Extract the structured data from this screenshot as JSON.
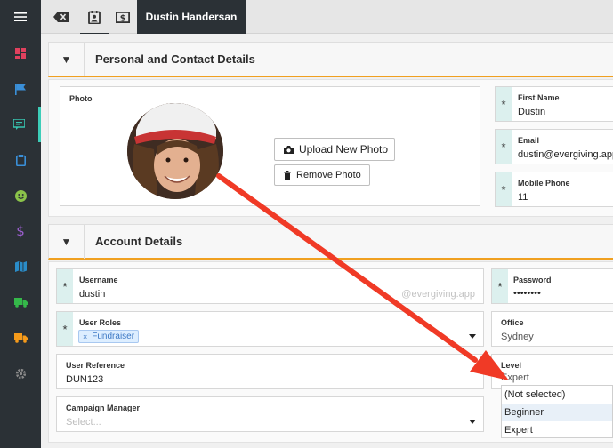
{
  "topbar": {
    "tab_name": "Dustin Handersan",
    "icons": [
      "backspace-icon",
      "contact-card-icon",
      "dollar-bill-icon"
    ]
  },
  "sidebar": {
    "items": [
      {
        "icon": "dashboard-icon",
        "color": "#e0415e"
      },
      {
        "icon": "flag-icon",
        "color": "#3a8fd8"
      },
      {
        "icon": "chat-icon",
        "color": "#37c5b0"
      },
      {
        "icon": "clipboard-icon",
        "color": "#3a8fd8"
      },
      {
        "icon": "smiley-icon",
        "color": "#8bc34a"
      },
      {
        "icon": "dollar-icon",
        "color": "#9c5fd0"
      },
      {
        "icon": "map-icon",
        "color": "#2a8cc8"
      },
      {
        "icon": "truck-icon",
        "color": "#35b84a"
      },
      {
        "icon": "truck-icon",
        "color": "#f59a1a"
      },
      {
        "icon": "gear-icon",
        "color": "#8a8a8a"
      }
    ]
  },
  "personal": {
    "title": "Personal and Contact Details",
    "photo_label": "Photo",
    "upload_label": "Upload New Photo",
    "remove_label": "Remove Photo",
    "first_name_label": "First Name",
    "first_name": "Dustin",
    "email_label": "Email",
    "email": "dustin@evergiving.app",
    "mobile_label": "Mobile Phone",
    "mobile": "11"
  },
  "account": {
    "title": "Account Details",
    "username_label": "Username",
    "username": "dustin",
    "username_suffix": "@evergiving.app",
    "password_label": "Password",
    "password": "••••••••",
    "roles_label": "User Roles",
    "roles": [
      "Fundraiser"
    ],
    "office_label": "Office",
    "office": "Sydney",
    "reference_label": "User Reference",
    "reference": "DUN123",
    "level_label": "Level",
    "level": "Expert",
    "level_options": [
      "(Not selected)",
      "Beginner",
      "Expert"
    ],
    "level_highlighted": "Beginner",
    "manager_label": "Campaign Manager",
    "manager_placeholder": "Select..."
  },
  "required_marker": "*",
  "annotation": {
    "color": "#f03a26"
  },
  "accent_color": "#f0a020"
}
